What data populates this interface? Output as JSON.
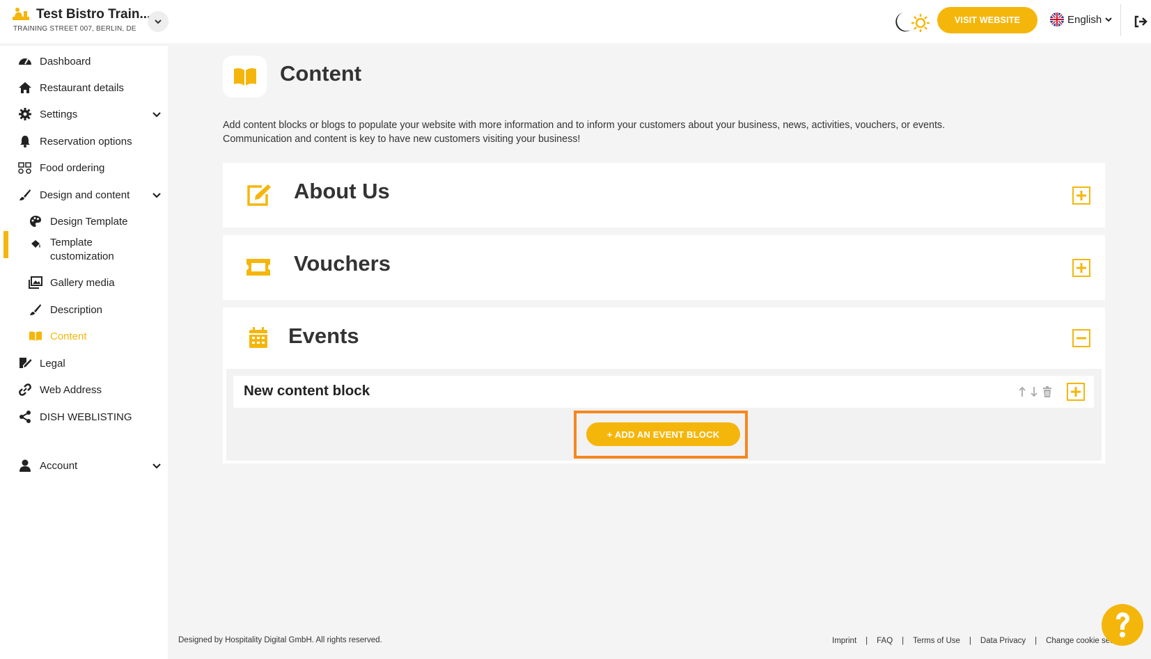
{
  "colors": {
    "accent": "#f5b60c",
    "highlight": "#f5871f",
    "background": "#f4f4f4"
  },
  "header": {
    "brand_icon": "chef-bistro-icon",
    "restaurant_name": "Test Bistro Train...",
    "address": "TRAINING STREET 007, BERLIN, DE",
    "visit_website": "VISIT WEBSITE",
    "language": "English"
  },
  "sidebar": {
    "items": [
      {
        "label": "Dashboard",
        "icon": "gauge-icon"
      },
      {
        "label": "Restaurant details",
        "icon": "home-icon"
      },
      {
        "label": "Settings",
        "icon": "gear-icon"
      },
      {
        "label": "Reservation options",
        "icon": "bell-icon"
      },
      {
        "label": "Food ordering",
        "icon": "food-delivery-icon"
      },
      {
        "label": "Design and content",
        "icon": "brush-icon"
      },
      {
        "label": "Design Template",
        "icon": "palette-icon"
      },
      {
        "label": "Template",
        "label2": "customization",
        "icon": "paint-can-icon"
      },
      {
        "label": "Gallery media",
        "icon": "images-icon"
      },
      {
        "label": "Description",
        "icon": "pen-brush-icon"
      },
      {
        "label": "Content",
        "icon": "book-icon"
      },
      {
        "label": "Legal",
        "icon": "signature-icon"
      },
      {
        "label": "Web Address",
        "icon": "link-icon"
      },
      {
        "label": "DISH WEBLISTING",
        "icon": "share-icon"
      },
      {
        "label": "Account",
        "icon": "user-icon"
      }
    ]
  },
  "main": {
    "title": "Content",
    "intro_line1": "Add content blocks or blogs to populate your website with more information and to inform your customers about your business, news, activities, vouchers, or events.",
    "intro_line2": "Communication and content is key to have new customers visiting your business!",
    "sections": [
      {
        "title": "About Us",
        "icon": "edit-icon",
        "state": "collapsed"
      },
      {
        "title": "Vouchers",
        "icon": "ticket-icon",
        "state": "collapsed"
      },
      {
        "title": "Events",
        "icon": "calendar-icon",
        "state": "expanded"
      }
    ],
    "block_title": "New content block",
    "add_event_button": "+ ADD AN EVENT BLOCK"
  },
  "footer": {
    "copyright": "Designed by Hospitality Digital GmbH. All rights reserved.",
    "links": [
      "Imprint",
      "FAQ",
      "Terms of Use",
      "Data Privacy",
      "Change cookie settings"
    ]
  }
}
